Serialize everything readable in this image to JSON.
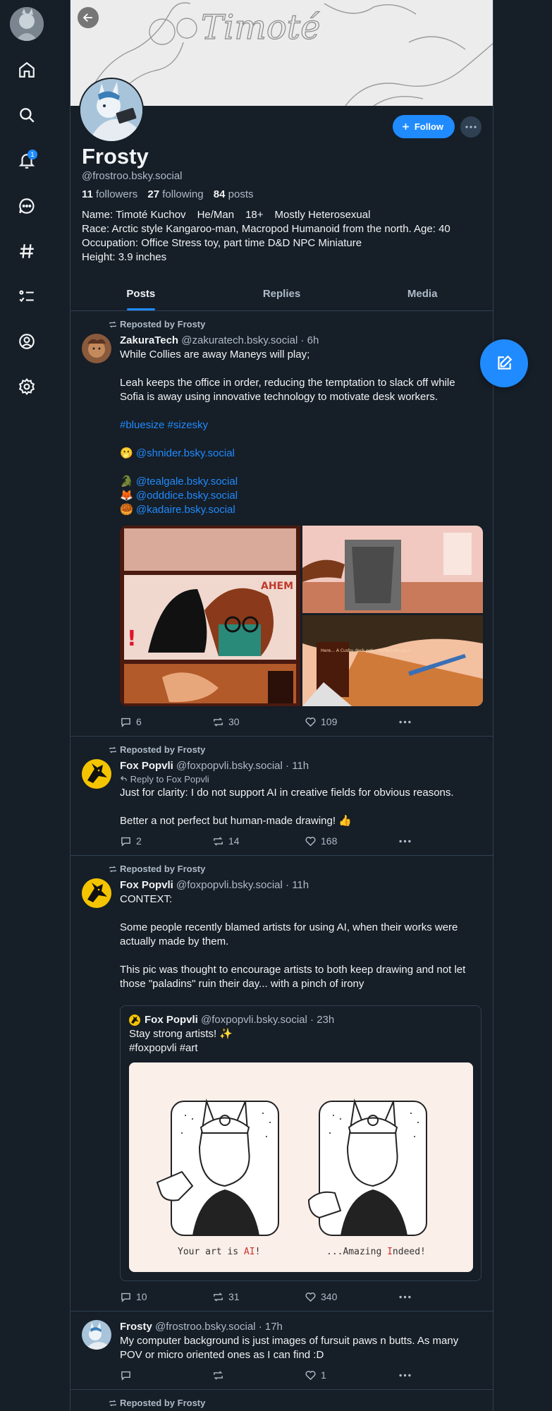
{
  "nav": {
    "notification_count": "1",
    "items": [
      "home",
      "search",
      "notifications",
      "chat",
      "feeds",
      "lists",
      "profile",
      "settings"
    ]
  },
  "profile": {
    "banner_text": "Timoté",
    "name": "Frosty",
    "handle": "@frostroo.bsky.social",
    "follow_label": "Follow",
    "followers_count": "11",
    "followers_label": "followers",
    "following_count": "27",
    "following_label": "following",
    "posts_count": "84",
    "posts_label": "posts",
    "bio": {
      "line1_a": "Name: Timoté Kuchov",
      "line1_b": "He/Man",
      "line1_c": "18+",
      "line1_d": "Mostly Heterosexual",
      "line2": "Race: Arctic style Kangaroo-man, Macropod Humanoid from the north. Age: 40",
      "line3": "Occupation: Office Stress toy, part time D&D NPC Miniature",
      "line4": "Height: 3.9 inches"
    }
  },
  "tabs": [
    {
      "label": "Posts"
    },
    {
      "label": "Replies"
    },
    {
      "label": "Media"
    }
  ],
  "posts": [
    {
      "repost_label": "Reposted by Frosty",
      "author": "ZakuraTech",
      "handle": "@zakuratech.bsky.social",
      "time": "· 6h",
      "text1": "While Collies are away Maneys will play;",
      "text2": "Leah keeps the office in order, reducing the temptation to slack off while Sofia is away using innovative technology to motivate desk workers.",
      "tags": "#bluesize #sizesky",
      "mention1_emoji": "🫢",
      "mention1": "@shnider.bsky.social",
      "mention2_emoji": "🐊",
      "mention2": "@tealgale.bsky.social",
      "mention3_emoji": "🦊",
      "mention3": "@odddice.bsky.social",
      "mention4_emoji": "🥮",
      "mention4": "@kadaire.bsky.social",
      "image_caption": "Here... A Cushy desk pal... Perfect for you!",
      "image_shout": "AHEM",
      "replies": "6",
      "reposts": "30",
      "likes": "109"
    },
    {
      "repost_label": "Reposted by Frosty",
      "author": "Fox Popvli",
      "handle": "@foxpopvli.bsky.social",
      "time": "· 11h",
      "reply_to": "Reply to Fox Popvli",
      "text1": "Just for clarity: I do not support AI in creative fields for obvious reasons.",
      "text2": "Better a not perfect but human-made drawing! 👍",
      "replies": "2",
      "reposts": "14",
      "likes": "168"
    },
    {
      "repost_label": "Reposted by Frosty",
      "author": "Fox Popvli",
      "handle": "@foxpopvli.bsky.social",
      "time": "· 11h",
      "text1": "CONTEXT:",
      "text2": "Some people recently blamed artists for using AI, when their works were actually made by them.",
      "text3": "This pic was thought to encourage artists to both keep drawing and not let those \"paladins\" ruin their day... with a pinch of irony",
      "quote": {
        "author": "Fox Popvli",
        "handle": "@foxpopvli.bsky.social",
        "time": "· 23h",
        "text1": "Stay strong artists! ✨",
        "text2": "#foxpopvli #art",
        "caption_left_a": "Your art is ",
        "caption_left_b": "AI",
        "caption_left_c": "!",
        "caption_right_a": "...Amazing ",
        "caption_right_b": "I",
        "caption_right_c": "ndeed!"
      },
      "replies": "10",
      "reposts": "31",
      "likes": "340"
    },
    {
      "author": "Frosty",
      "handle": "@frostroo.bsky.social",
      "time": "· 17h",
      "text1": "My computer background is just images of fursuit paws n butts. As many POV or micro oriented ones as I can find :D",
      "replies": "",
      "reposts": "",
      "likes": "1"
    },
    {
      "repost_label": "Reposted by Frosty"
    }
  ],
  "colors": {
    "background": "#161e27",
    "accent": "#208bfe",
    "border": "#2e4052",
    "muted": "#aebbc9"
  }
}
